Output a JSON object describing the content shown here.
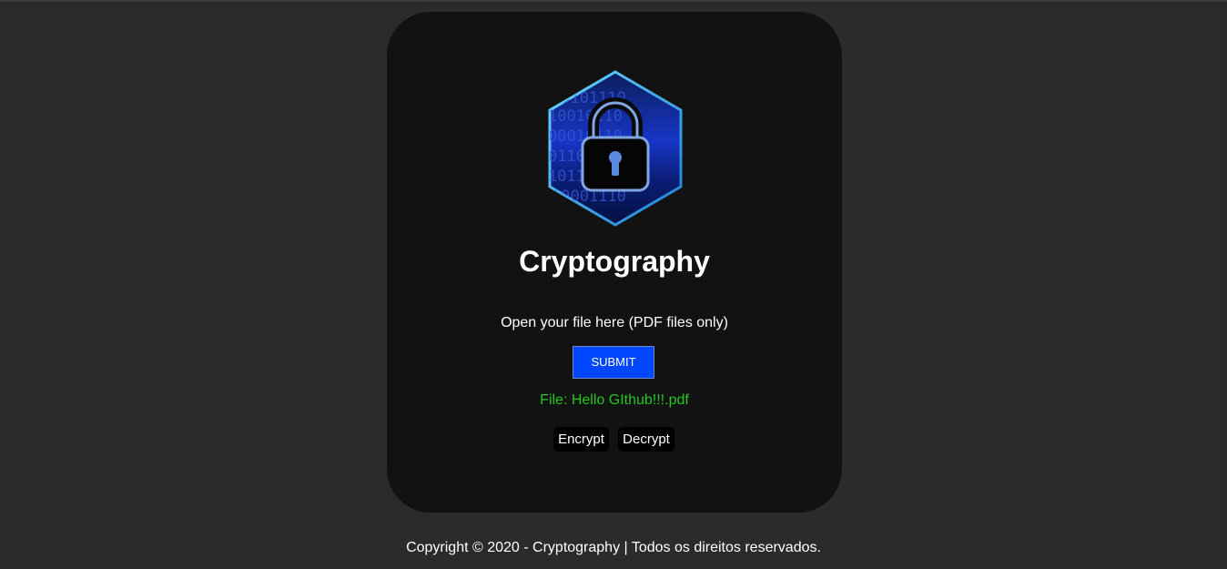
{
  "card": {
    "title": "Cryptography",
    "open_label": "Open your file here (PDF files only)",
    "submit_label": "SUBMIT",
    "file_status": "File: Hello GIthub!!!.pdf",
    "encrypt_label": "Encrypt",
    "decrypt_label": "Decrypt"
  },
  "logo": {
    "icon": "padlock-hexagon-icon",
    "binary_text": [
      "10101110",
      "10010110",
      "00010110",
      "01100110",
      "10110111",
      "10001110",
      "10001110"
    ]
  },
  "footer": {
    "text": "Copyright © 2020 - Cryptography | Todos os direitos reservados."
  },
  "colors": {
    "background": "#2c2a2b",
    "card": "#121212",
    "submit": "#0047ff",
    "file_status": "#22c722"
  }
}
